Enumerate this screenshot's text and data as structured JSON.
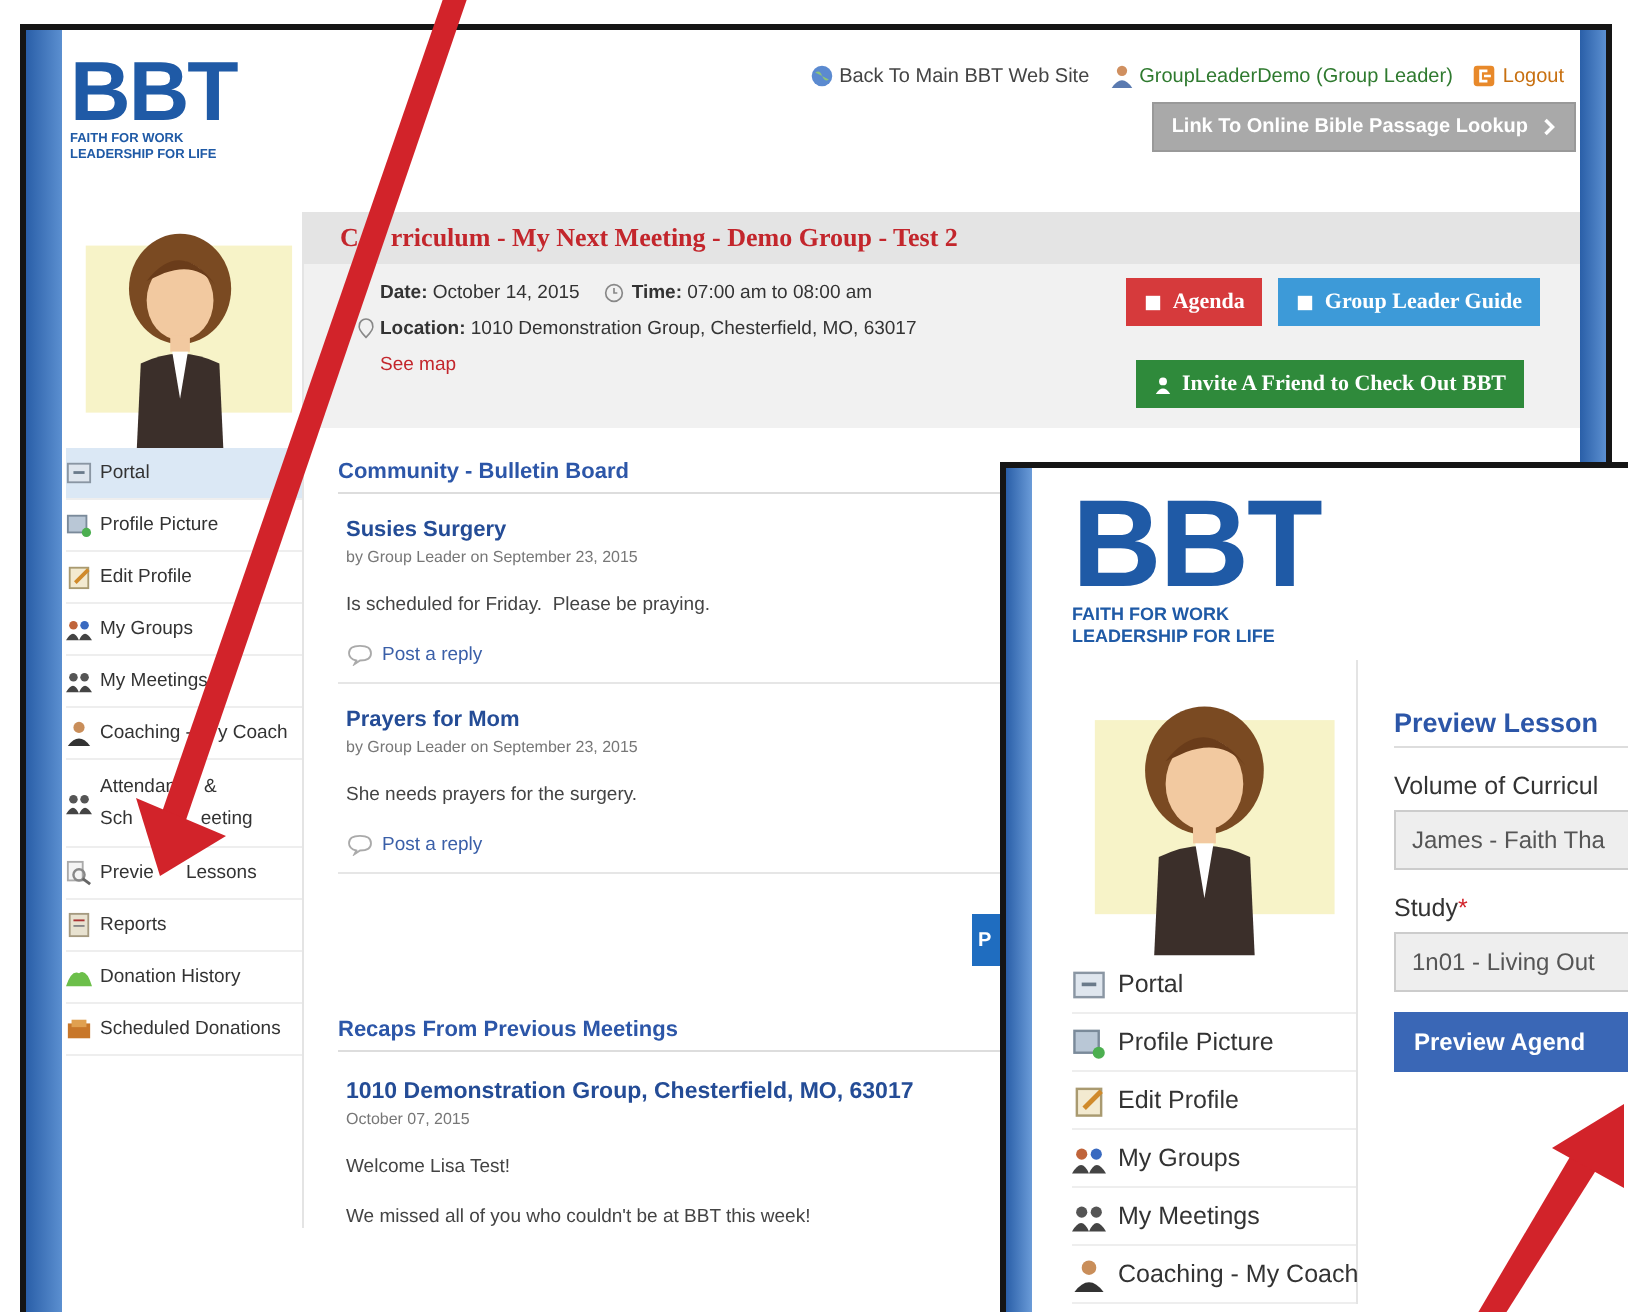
{
  "main_page": {
    "logo": {
      "mark": "BBT",
      "tagline_1": "FAITH FOR WORK",
      "tagline_2": "LEADERSHIP FOR LIFE"
    },
    "header_links": [
      {
        "kind": "globe",
        "text": "Back To Main BBT Web Site"
      },
      {
        "kind": "user",
        "text": "GroupLeaderDemo (Group Leader)"
      },
      {
        "kind": "logout",
        "text": "Logout"
      }
    ],
    "lookup_button": "Link To Online Bible Passage Lookup",
    "sidebar": {
      "items": [
        {
          "label": "Portal",
          "selected": true
        },
        {
          "label": "Profile Picture",
          "selected": false
        },
        {
          "label": "Edit Profile",
          "selected": false
        },
        {
          "label": "My Groups",
          "selected": false
        },
        {
          "label": "My Meetings",
          "selected": false
        },
        {
          "parts": [
            "Coaching -",
            "y Coach"
          ],
          "selected": false
        },
        {
          "lines": [
            [
              "Attendan",
              "&"
            ],
            [
              "Sch",
              "eeting"
            ]
          ],
          "selected": false
        },
        {
          "parts": [
            "Previe",
            "Lessons"
          ],
          "selected": false
        },
        {
          "label": "Reports",
          "selected": false
        },
        {
          "label": "Donation History",
          "selected": false
        },
        {
          "label": "Scheduled Donations",
          "selected": false
        }
      ]
    },
    "meeting": {
      "title_parts": [
        "C",
        "rriculum - My Next Meeting - Demo Group - Test 2"
      ],
      "date": "**Date:** October 14, 2015",
      "time": "**Time:** 07:00 am to 08:00 am",
      "location": "**Location:** 1010 Demonstration Group, Chesterfield, MO, 63017",
      "map_link": "See map",
      "buttons": [
        {
          "kind": "agenda",
          "label": "Agenda"
        },
        {
          "kind": "guide",
          "label": "Group Leader Guide"
        },
        {
          "kind": "invite",
          "label": "Invite A Friend to Check Out BBT"
        }
      ]
    },
    "bulletin": {
      "heading": "Community - Bulletin Board",
      "posts": [
        {
          "title": "Susies Surgery",
          "byline": "by Group Leader on September 23, 2015",
          "body": "Is scheduled for Friday.  Please be praying.",
          "reply": "Post a reply"
        },
        {
          "title": "Prayers for Mom",
          "byline": "by Group Leader on September 23, 2015",
          "body": "She needs prayers for the surgery.",
          "reply": "Post a reply"
        }
      ],
      "button": "P"
    },
    "recaps": {
      "heading": "Recaps From Previous Meetings",
      "entries": [
        {
          "title": "1010 Demonstration Group, Chesterfield, MO, 63017",
          "date": "October 07, 2015",
          "paragraphs": [
            "Welcome Lisa Test!",
            "We missed all of you who couldn't be at BBT this week!"
          ]
        }
      ]
    }
  },
  "preview_window": {
    "logo": {
      "mark": "BBT",
      "tagline_1": "FAITH FOR WORK",
      "tagline_2": "LEADERSHIP FOR LIFE"
    },
    "sidebar": {
      "items": [
        {
          "label": "Portal",
          "selected": false
        },
        {
          "label": "Profile Picture",
          "selected": false
        },
        {
          "label": "Edit Profile",
          "selected": false
        },
        {
          "label": "My Groups",
          "selected": false
        },
        {
          "label": "My Meetings",
          "selected": false
        },
        {
          "label": "Coaching - My Coach",
          "selected": false
        }
      ]
    },
    "heading": "Preview Lesson",
    "required_mark": "*",
    "fields": [
      {
        "label": "Volume of Curricul",
        "required": false,
        "value": "James - Faith Tha"
      },
      {
        "label": "Study",
        "required": true,
        "value": "1n01 - Living Out"
      }
    ],
    "button": "Preview Agend"
  }
}
